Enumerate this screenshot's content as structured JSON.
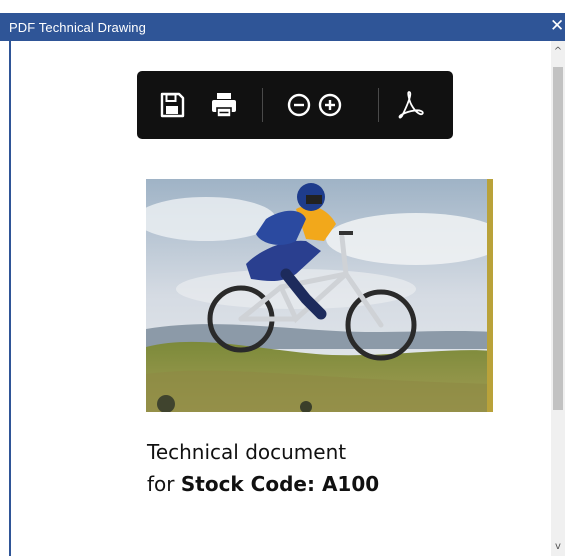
{
  "window": {
    "title": "PDF Technical Drawing",
    "close_glyph": "✕"
  },
  "toolbar": {
    "buttons": [
      "save-icon",
      "print-icon",
      "zoom-out-icon",
      "zoom-in-icon",
      "acrobat-icon"
    ]
  },
  "document": {
    "image": "mountain-bike-rider-photo",
    "line1": "Technical document",
    "line2_prefix": "for ",
    "line2_bold": "Stock Code: A100"
  },
  "scrollbar": {
    "up_glyph": "^",
    "down_glyph": "v"
  },
  "colors": {
    "titlebar": "#2f5597",
    "toolbar": "#111111",
    "scroll_thumb": "#c2c2c2"
  }
}
